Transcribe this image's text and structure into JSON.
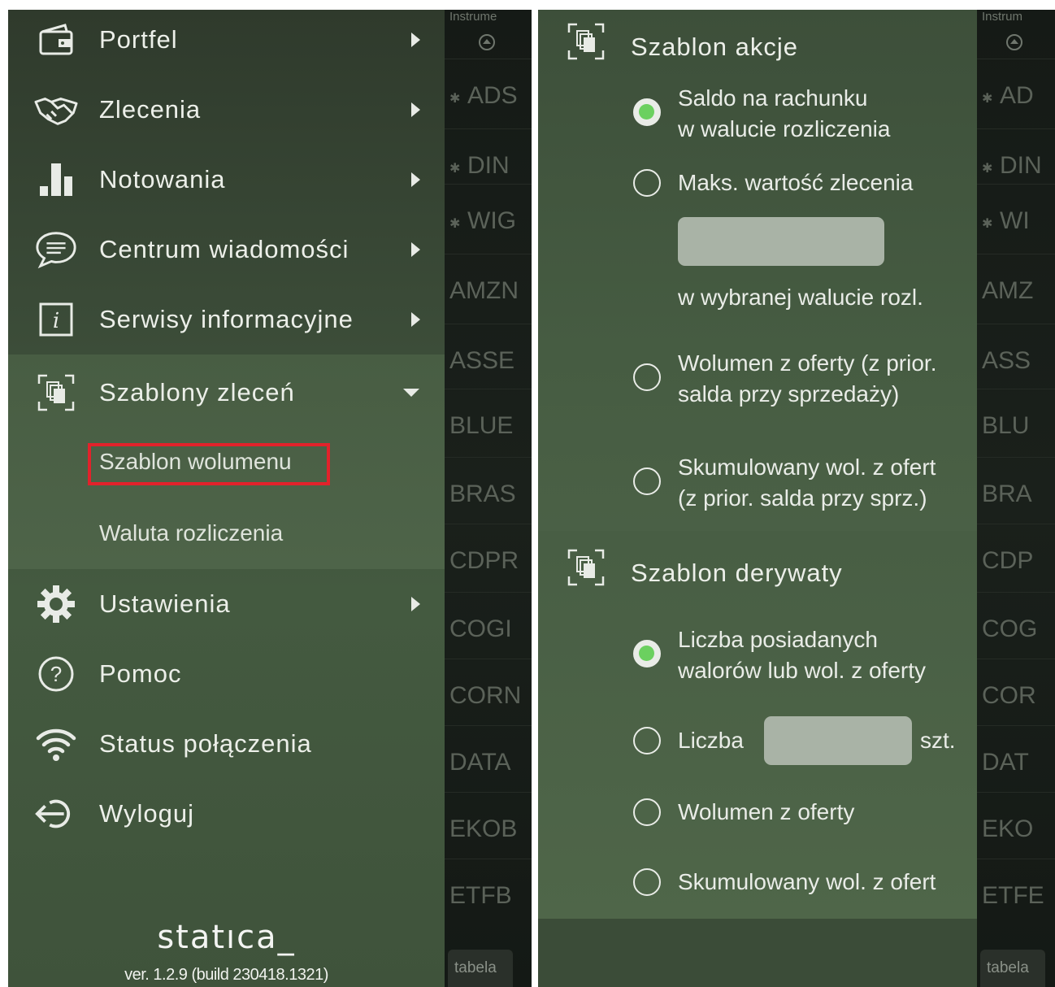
{
  "menu": {
    "items": [
      {
        "label": "Portfel",
        "icon": "wallet-icon"
      },
      {
        "label": "Zlecenia",
        "icon": "handshake-icon"
      },
      {
        "label": "Notowania",
        "icon": "bar-chart-icon"
      },
      {
        "label": "Centrum wiadomości",
        "icon": "chat-bubble-icon"
      },
      {
        "label": "Serwisy informacyjne",
        "icon": "info-icon"
      },
      {
        "label": "Szablony zleceń",
        "icon": "template-icon"
      },
      {
        "label": "Ustawienia",
        "icon": "gear-icon"
      },
      {
        "label": "Pomoc",
        "icon": "help-icon"
      },
      {
        "label": "Status połączenia",
        "icon": "wifi-icon"
      },
      {
        "label": "Wyloguj",
        "icon": "logout-icon"
      }
    ],
    "submenu": [
      "Szablon wolumenu",
      "Waluta rozliczenia"
    ],
    "logo": "statıca_",
    "version": "ver. 1.2.9 (build 230418.1321)"
  },
  "instrument_list": {
    "header": "Instrume",
    "header_right": "Instrum",
    "rows": [
      "ADS",
      "DIN",
      "WIG",
      "AMZN",
      "ASSE",
      "BLUE",
      "BRAS",
      "CDPR",
      "COGI",
      "CORN",
      "DATA",
      "EKOB",
      "ETFB"
    ],
    "rows_right": [
      "AD",
      "DIN",
      "WI",
      "AMZ",
      "ASS",
      "BLU",
      "BRA",
      "CDP",
      "COG",
      "COR",
      "DAT",
      "EKO",
      "ETFE"
    ],
    "footer": "tabela"
  },
  "templates": {
    "akcje": {
      "title": "Szablon akcje",
      "options": [
        {
          "line1": "Saldo na rachunku",
          "line2": "w walucie rozliczenia",
          "selected": true
        },
        {
          "line1": "Maks. wartość zlecenia",
          "note": "w wybranej walucie rozl.",
          "selected": false
        },
        {
          "line1": "Wolumen z oferty (z prior.",
          "line2": "salda przy sprzedaży)",
          "selected": false
        },
        {
          "line1": "Skumulowany wol. z ofert",
          "line2": "(z prior. salda przy sprz.)",
          "selected": false
        }
      ]
    },
    "derywaty": {
      "title": "Szablon derywaty",
      "options": [
        {
          "line1": "Liczba posiadanych",
          "line2": "walorów lub wol. z oferty",
          "selected": true
        },
        {
          "line1": "Liczba",
          "unit": "szt.",
          "selected": false
        },
        {
          "line1": "Wolumen z oferty",
          "selected": false
        },
        {
          "line1": "Skumulowany wol. z ofert",
          "selected": false
        }
      ]
    }
  },
  "colors": {
    "panel_green": "#465c42",
    "radio_selected": "#6bd05f",
    "highlight": "#e2222b"
  }
}
